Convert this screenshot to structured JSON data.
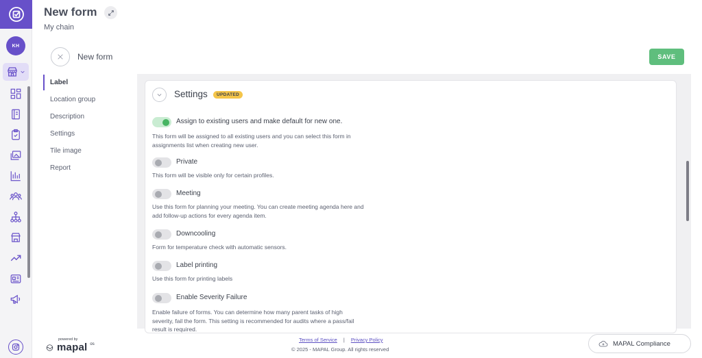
{
  "user": {
    "initials": "KH"
  },
  "header": {
    "title": "New form",
    "subtitle": "My chain"
  },
  "form_bar": {
    "name": "New form",
    "save_label": "SAVE"
  },
  "sidenav": {
    "items": [
      {
        "label": "Label",
        "active": true
      },
      {
        "label": "Location group",
        "active": false
      },
      {
        "label": "Description",
        "active": false
      },
      {
        "label": "Settings",
        "active": false
      },
      {
        "label": "Tile image",
        "active": false
      },
      {
        "label": "Report",
        "active": false
      }
    ]
  },
  "settings_card": {
    "title": "Settings",
    "badge": "UPDATED",
    "options": [
      {
        "label": "Assign to existing users and make default for new one.",
        "enabled": true,
        "description": "This form will be assigned to all existing users and you can select this form in assignments list when creating new user."
      },
      {
        "label": "Private",
        "enabled": false,
        "description": "This form will be visible only for certain profiles."
      },
      {
        "label": "Meeting",
        "enabled": false,
        "description": "Use this form for planning your meeting. You can create meeting agenda here and add follow-up actions for every agenda item."
      },
      {
        "label": "Downcooling",
        "enabled": false,
        "description": "Form for temperature check with automatic sensors."
      },
      {
        "label": "Label printing",
        "enabled": false,
        "description": "Use this form for printing labels"
      },
      {
        "label": "Enable Severity Failure",
        "enabled": false,
        "description": "Enable failure of forms. You can determine how many parent tasks of high severity, fail the form. This setting is recommended for audits where a pass/fail result is required."
      }
    ]
  },
  "footer": {
    "powered_by": "powered by",
    "brand": "mapal",
    "brand_suffix": "os",
    "terms": "Terms of Service",
    "separator": "|",
    "privacy": "Privacy Policy",
    "copyright": "© 2025 - MAPAL Group. All rights reserved",
    "compliance_label": "MAPAL Compliance"
  },
  "colors": {
    "accent": "#6750c9",
    "save": "#5fbe7d",
    "toggle_on": "#46b562",
    "badge": "#f4c54a"
  },
  "icons": [
    "app-logo-icon",
    "store-icon",
    "chevron-down-icon",
    "dashboard-icon",
    "book-icon",
    "checklist-icon",
    "gallery-icon",
    "chart-icon",
    "people-icon",
    "hierarchy-icon",
    "shop-icon",
    "trend-icon",
    "news-icon",
    "megaphone-icon",
    "instagram-icon",
    "expand-icon",
    "close-icon",
    "collapse-chevron-icon",
    "wave-icon",
    "cloud-icon"
  ]
}
